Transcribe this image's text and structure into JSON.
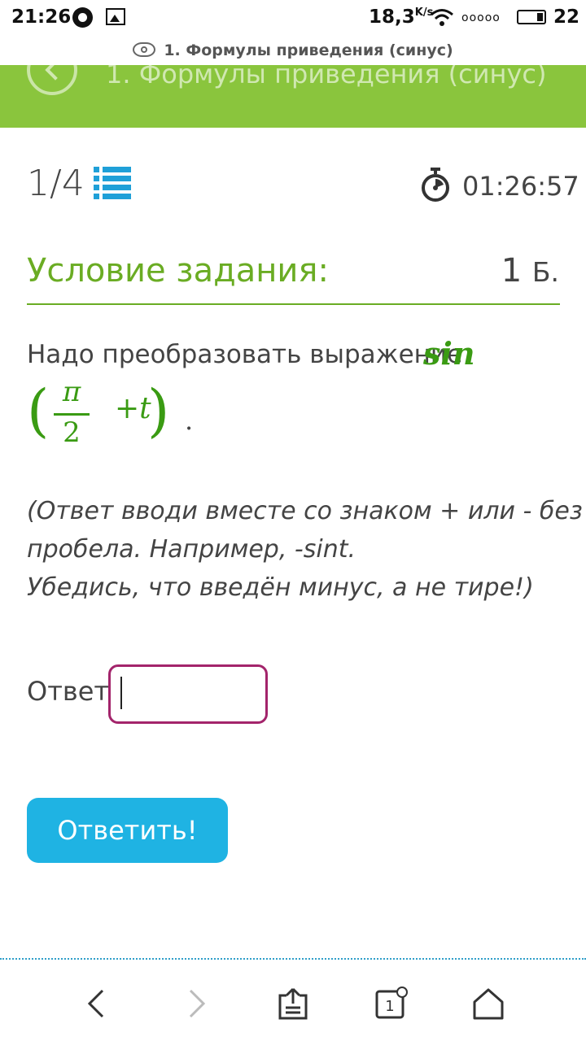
{
  "status_bar": {
    "time": "21:26",
    "speed": "18,3",
    "speed_unit": "K/s",
    "signal": "ooooo",
    "battery": "22"
  },
  "url_bar": {
    "title": "1. Формулы приведения (синус)"
  },
  "header": {
    "title": "1. Формулы приведения (синус)"
  },
  "progress": {
    "text": "1/4"
  },
  "timer": {
    "text": "01:26:57"
  },
  "condition": {
    "title": "Условие задания:",
    "points": "1",
    "points_unit": "Б."
  },
  "task": {
    "text": "Надо преобразовать выражение",
    "math": {
      "func": "sin",
      "num": "π",
      "den": "2",
      "plus": "+",
      "var": "t"
    },
    "end": "."
  },
  "hint": {
    "line1": "(Ответ вводи вместе со знаком + или - без",
    "line2": "пробела. Например, -sint.",
    "line3": "Убедись, что введён минус, а не тире!)"
  },
  "answer": {
    "label": "Ответ:",
    "value": ""
  },
  "submit": {
    "label": "Ответить!"
  },
  "colors": {
    "green": "#8ac53d",
    "accent_green": "#6aac23",
    "button_blue": "#1fb3e3",
    "input_border": "#a3246b"
  },
  "icons": [
    "eye-icon",
    "back-icon",
    "list-icon",
    "timer-icon",
    "nav-back-icon",
    "nav-forward-icon",
    "share-icon",
    "tabs-icon",
    "home-icon"
  ],
  "nav": {
    "tabs_count": "1"
  }
}
